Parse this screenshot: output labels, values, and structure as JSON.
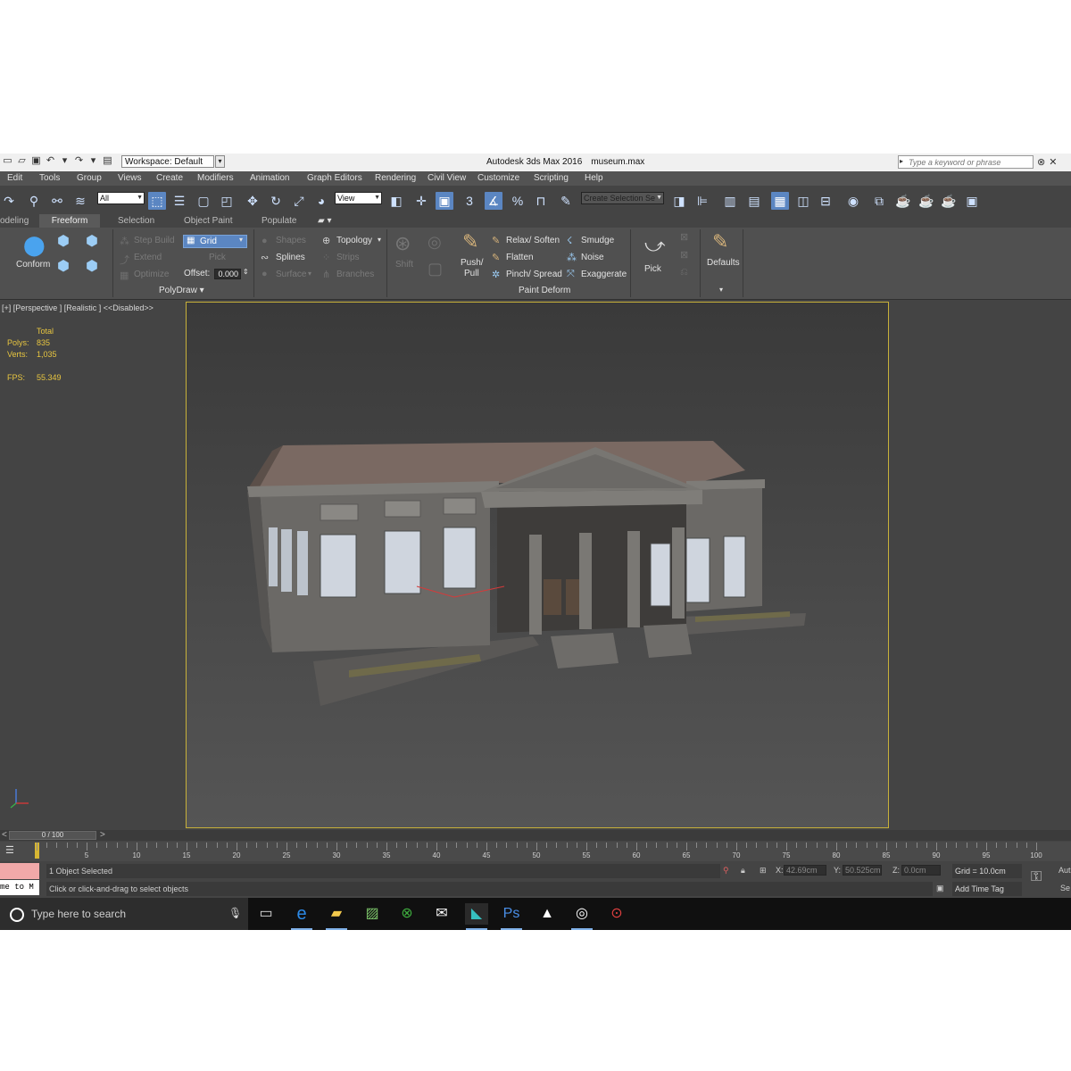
{
  "window": {
    "workspace_label": "Workspace: Default",
    "app_title": "Autodesk 3ds Max 2016",
    "file_name": "museum.max",
    "search_placeholder": "Type a keyword or phrase"
  },
  "menu": [
    "Edit",
    "Tools",
    "Group",
    "Views",
    "Create",
    "Modifiers",
    "Animation",
    "Graph Editors",
    "Rendering",
    "Civil View",
    "Customize",
    "Scripting",
    "Help"
  ],
  "toolbar": {
    "selection_filter": "All",
    "ref_coord": "View",
    "named_selection": "Create Selection Se",
    "snap_label": "3"
  },
  "ribbon": {
    "tabs": [
      "odeling",
      "Freeform",
      "Selection",
      "Object Paint",
      "Populate"
    ],
    "active_tab": "Freeform",
    "conform_label": "Conform",
    "step_build": "Step Build",
    "extend": "Extend",
    "optimize": "Optimize",
    "grid": "Grid",
    "pick": "Pick",
    "offset_label": "Offset:",
    "offset_value": "0.000",
    "shapes": "Shapes",
    "topology": "Topology",
    "splines": "Splines",
    "strips": "Strips",
    "surface": "Surface",
    "branches": "Branches",
    "polydraw_panel": "PolyDraw",
    "shift": "Shift",
    "push_pull_1": "Push/",
    "push_pull_2": "Pull",
    "relax_soften": "Relax/ Soften",
    "flatten": "Flatten",
    "pinch_spread": "Pinch/ Spread",
    "smudge": "Smudge",
    "noise": "Noise",
    "exaggerate": "Exaggerate",
    "paint_deform_panel": "Paint Deform",
    "pick_big": "Pick",
    "defaults": "Defaults"
  },
  "viewport": {
    "label": "[+] [Perspective ] [Realistic ]  <<Disabled>>",
    "stats_header": "Total",
    "polys_label": "Polys:",
    "polys_value": "835",
    "verts_label": "Verts:",
    "verts_value": "1,035",
    "fps_label": "FPS:",
    "fps_value": "55.349"
  },
  "timeline": {
    "frame_display": "0 / 100",
    "prev": "<",
    "next": ">",
    "ticks": [
      "5",
      "10",
      "15",
      "20",
      "25",
      "30",
      "35",
      "40",
      "45",
      "50",
      "55",
      "60",
      "65",
      "70",
      "75",
      "80",
      "85",
      "90",
      "95",
      "100"
    ]
  },
  "status": {
    "maxscript_text": "me to M",
    "selected": "1 Object Selected",
    "prompt": "Click or click-and-drag to select objects",
    "x_label": "X:",
    "x_value": "42.69cm",
    "y_label": "Y:",
    "y_value": "50.525cm",
    "z_label": "Z:",
    "z_value": "0.0cm",
    "grid": "Grid = 10.0cm",
    "add_time_tag": "Add Time Tag",
    "auto": "Aut",
    "set": "Se"
  },
  "taskbar": {
    "search_text": "Type here to search"
  },
  "colors": {
    "accent": "#5b86c2",
    "stats": "#e8c640",
    "viewport_border": "#c8b13a",
    "timeline_marker": "#d7b632"
  }
}
